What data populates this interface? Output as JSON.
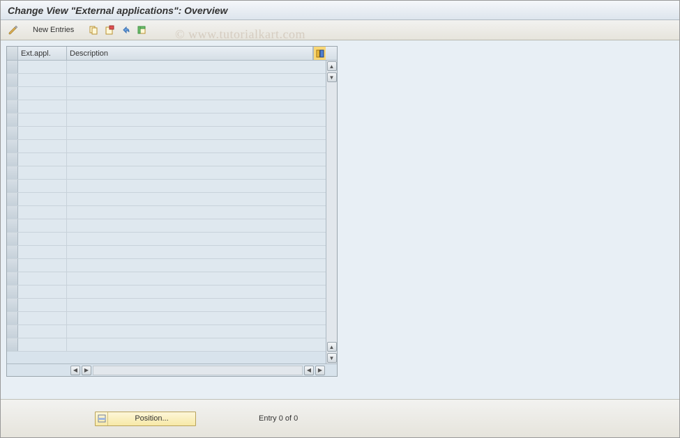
{
  "title": "Change View \"External applications\": Overview",
  "toolbar": {
    "new_entries_label": "New Entries"
  },
  "grid": {
    "col_ext": "Ext.appl.",
    "col_desc": "Description",
    "row_count": 22,
    "rows": []
  },
  "footer": {
    "position_label": "Position...",
    "entry_text": "Entry 0 of 0"
  },
  "watermark": "© www.tutorialkart.com"
}
